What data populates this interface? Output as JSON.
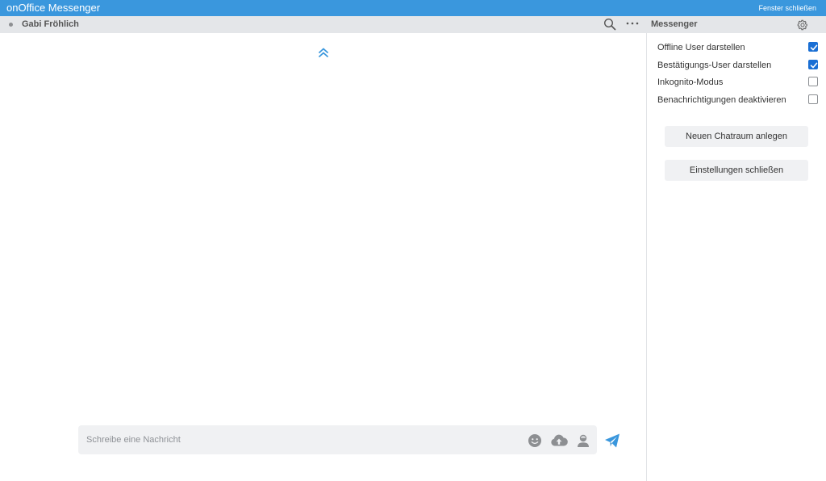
{
  "titlebar": {
    "app_title": "onOffice Messenger",
    "close_label": "Fenster schließen"
  },
  "chat": {
    "contact_name": "Gabi Fröhlich",
    "status": "offline"
  },
  "settings": {
    "title": "Messenger",
    "options": [
      {
        "label": "Offline User darstellen",
        "checked": true
      },
      {
        "label": "Bestätigungs-User darstellen",
        "checked": true
      },
      {
        "label": "Inkognito-Modus",
        "checked": false
      },
      {
        "label": "Benachrichtigungen deaktivieren",
        "checked": false
      }
    ],
    "new_room_label": "Neuen Chatraum anlegen",
    "close_settings_label": "Einstellungen schließen"
  },
  "composer": {
    "placeholder": "Schreibe eine Nachricht",
    "value": ""
  },
  "icons": [
    "search-icon",
    "more-icon",
    "gear-icon",
    "double-chevron-up-icon",
    "emoji-icon",
    "upload-icon",
    "contact-icon",
    "send-icon"
  ],
  "colors": {
    "accent": "#3a97dd",
    "header_bg": "#e4e6e9",
    "checkbox": "#1a6fd4",
    "icon_gray": "#8d8f92"
  }
}
